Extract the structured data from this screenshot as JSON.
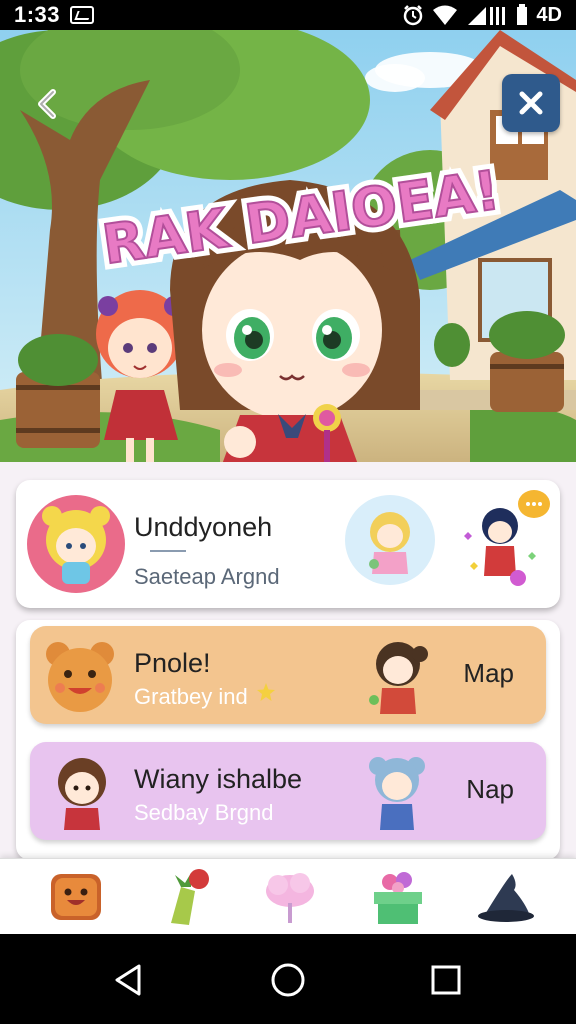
{
  "status_bar": {
    "time": "1:33",
    "network": "4D",
    "icons": [
      "notification-icon",
      "alarm-icon",
      "wifi-icon",
      "signal-icon",
      "battery-icon"
    ]
  },
  "hero": {
    "game_title": "RAK DAIOEA!",
    "back_icon": "back-arrow-icon",
    "close_icon": "close-icon"
  },
  "card_top": {
    "title": "Unddyoneh",
    "subtitle": "Saeteap Argnd"
  },
  "list": [
    {
      "title": "Pnole!",
      "subtitle": "Gratbey ind",
      "action": "Map"
    },
    {
      "title": "Wiany ishalbe",
      "subtitle": "Sedbay Brgnd",
      "action": "Nap"
    }
  ],
  "dock": [
    "toast-icon",
    "vegetable-icon",
    "cotton-candy-icon",
    "gift-box-icon",
    "wizard-hat-icon"
  ],
  "nav": [
    "back-triangle-icon",
    "home-circle-icon",
    "recents-square-icon"
  ],
  "colors": {
    "accent_blue": "#2f5a8c",
    "item_orange": "#f3c58f",
    "item_purple": "#e8c4ef"
  }
}
